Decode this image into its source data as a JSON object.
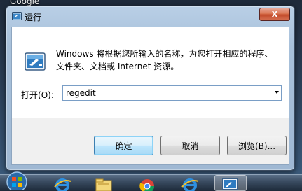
{
  "desktop": {
    "top_label": "Google"
  },
  "window": {
    "title": "运行",
    "close_symbol": "X"
  },
  "dialog": {
    "description": "Windows 将根据您所输入的名称，为您打开相应的程序、文件夹、文档或 Internet 资源。",
    "open_label_prefix": "打开(",
    "open_label_accel": "O",
    "open_label_suffix": "):",
    "input_value": "regedit"
  },
  "buttons": {
    "ok": "确定",
    "cancel": "取消",
    "browse": "浏览(B)..."
  },
  "taskbar": {
    "items": [
      "start-orb-icon",
      "internet-explorer-icon",
      "windows-explorer-icon",
      "chrome-icon",
      "internet-explorer-icon",
      "run-app-icon"
    ]
  },
  "colors": {
    "ok_border": "#3c7fb1",
    "titlebar": "#b9cfe6",
    "close": "#c24a2a"
  }
}
